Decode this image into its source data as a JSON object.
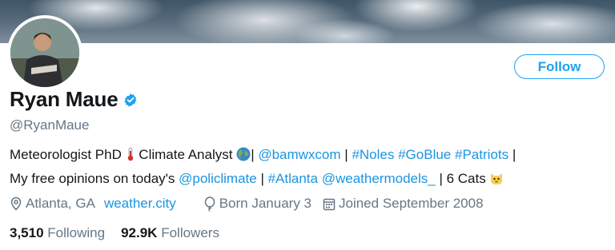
{
  "profile": {
    "name": "Ryan Maue",
    "handle": "@RyanMaue",
    "follow_label": "Follow",
    "bio": {
      "line1": {
        "t1": "Meteorologist PhD ",
        "t2": " Climate Analyst ",
        "t3": "| ",
        "mention_bamwx": "@bamwxcom",
        "t4": " | ",
        "tag_noles": "#Noles",
        "tag_goblue": "#GoBlue",
        "tag_patriots": "#Patriots",
        "t5": " |"
      },
      "line2": {
        "t1": "My free opinions on today's ",
        "mention_policlimate": "@policlimate",
        "t2": " | ",
        "tag_atlanta": "#Atlanta",
        "mention_weathermodels": "@weathermodels_",
        "t3": " | 6 Cats "
      }
    },
    "location": "Atlanta, GA",
    "website": "weather.city",
    "birthday": "Born January 3",
    "joined": "Joined September 2008",
    "following_count": "3,510",
    "following_label": "Following",
    "followers_count": "92.9K",
    "followers_label": "Followers"
  },
  "icons": {
    "verified": "verified-badge-icon",
    "thermometer": "thermometer-emoji",
    "globe": "globe-emoji",
    "cat": "cat-emoji",
    "location": "location-pin-icon",
    "birthday": "balloon-icon",
    "calendar": "calendar-icon"
  },
  "colors": {
    "accent": "#1da1f2",
    "link": "#1b95e0",
    "secondary_text": "#657786",
    "primary_text": "#14171a"
  }
}
